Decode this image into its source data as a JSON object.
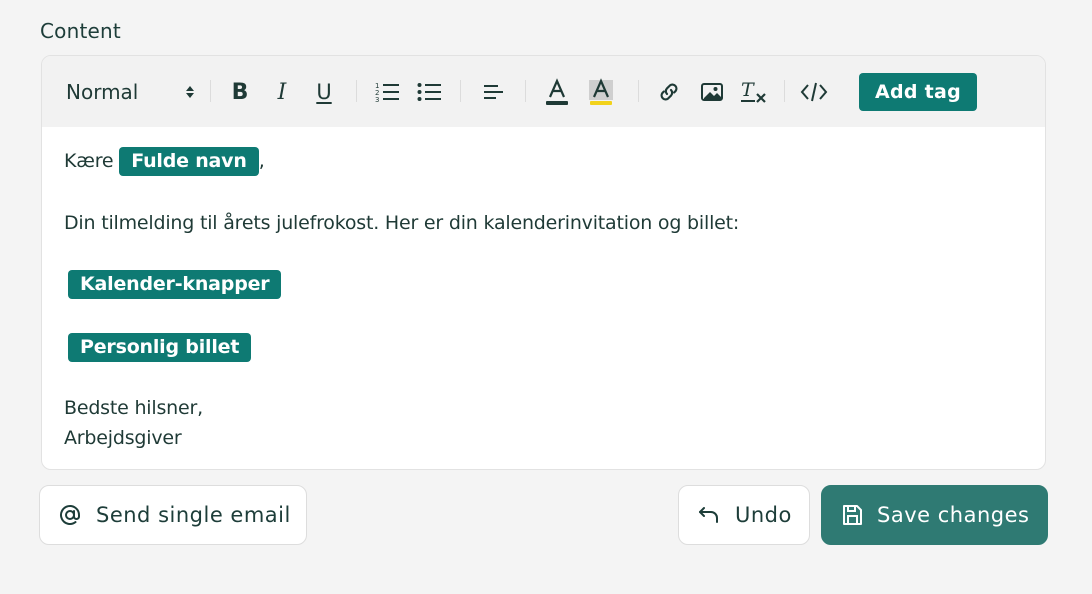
{
  "section": {
    "label": "Content"
  },
  "toolbar": {
    "format_value": "Normal",
    "bold_label": "B",
    "italic_label": "I",
    "underline_label": "U",
    "add_tag_label": "Add tag",
    "icons": [
      "bold-icon",
      "italic-icon",
      "underline-icon",
      "ordered-list-icon",
      "bullet-list-icon",
      "align-left-icon",
      "text-color-icon",
      "highlight-color-icon",
      "link-icon",
      "image-icon",
      "clear-format-icon",
      "code-icon"
    ]
  },
  "content": {
    "greeting_prefix": "Kære",
    "greeting_tag": "Fulde navn",
    "greeting_suffix": ",",
    "paragraph": "Din tilmelding til årets julefrokost. Her er din kalenderinvitation og billet:",
    "calendar_tag": "Kalender-knapper",
    "ticket_tag": "Personlig billet",
    "closing_line": "Bedste hilsner,",
    "signature": "Arbejdsgiver"
  },
  "actions": {
    "send_single_label": "Send single email",
    "undo_label": "Undo",
    "save_label": "Save changes"
  },
  "colors": {
    "accent": "#0e7a73",
    "primary_button": "#2f7a73",
    "text": "#1f3a36",
    "background": "#f4f4f4"
  }
}
